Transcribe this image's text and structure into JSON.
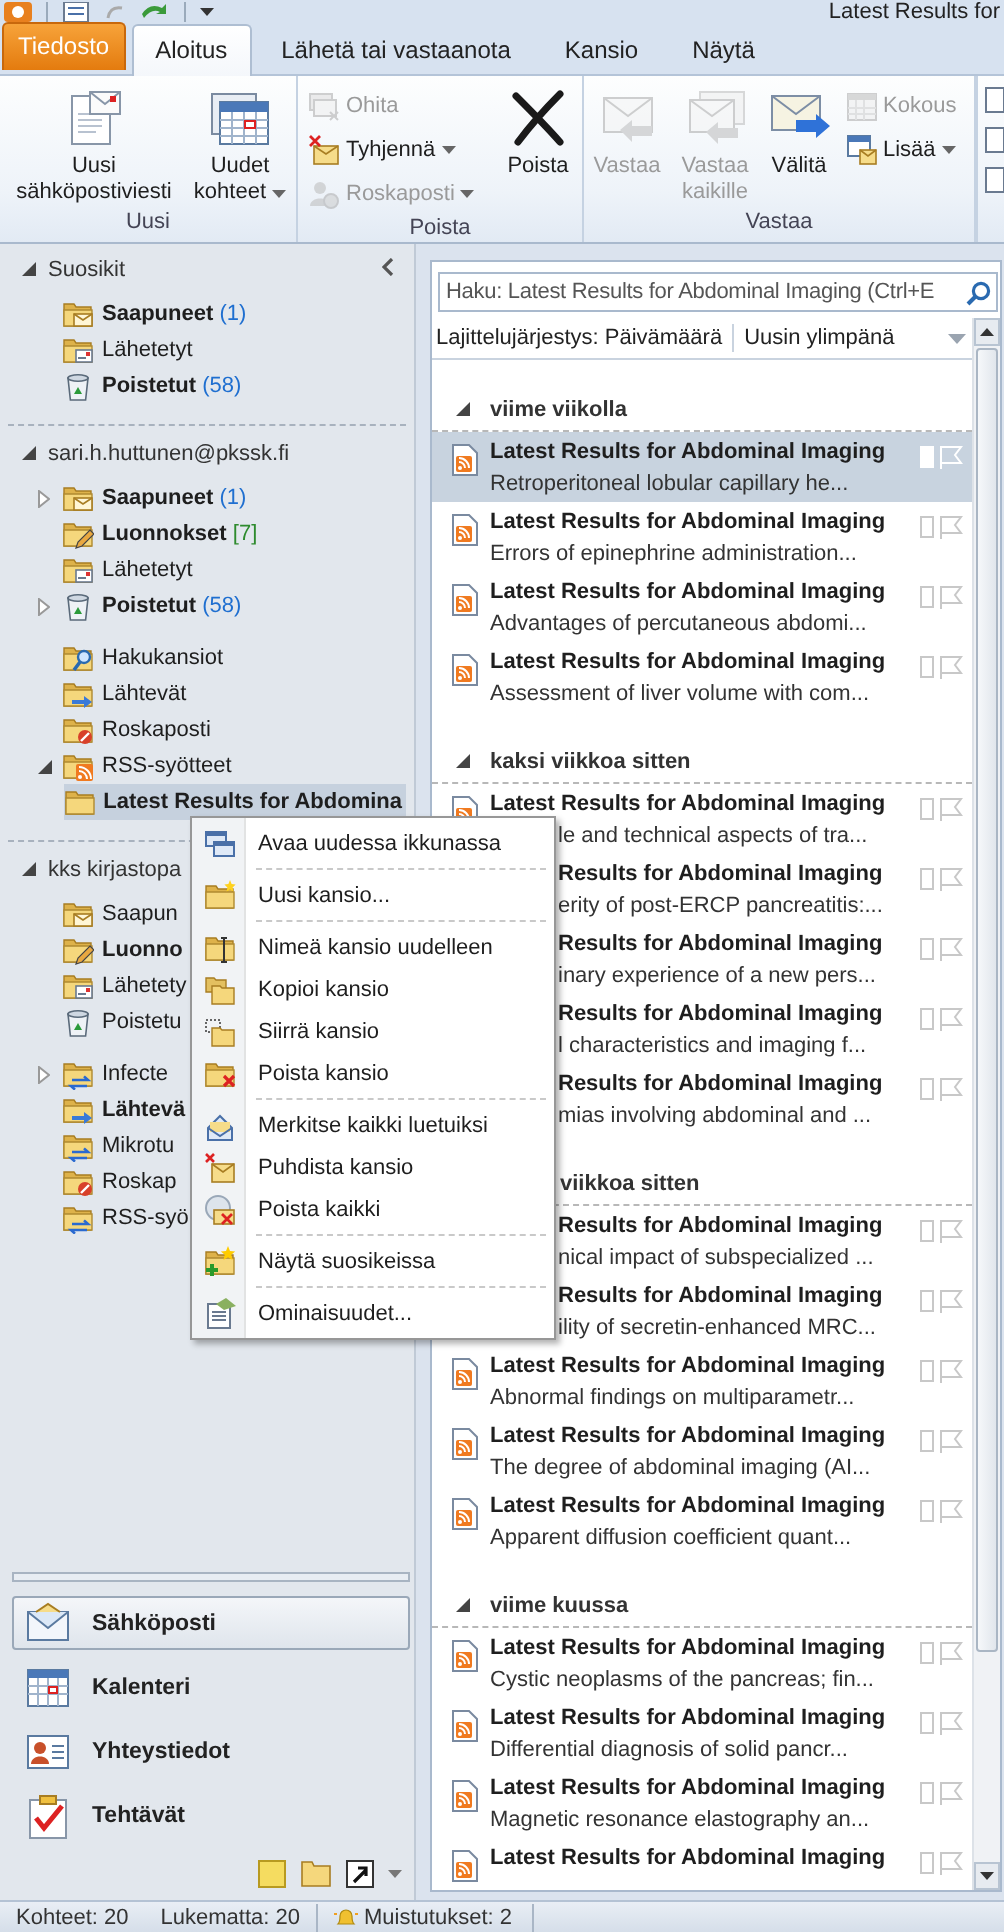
{
  "window": {
    "title": "Latest Results for"
  },
  "tabs": [
    {
      "label": "Tiedosto",
      "kind": "file",
      "selected": false
    },
    {
      "label": "Aloitus",
      "kind": "tab",
      "selected": true
    },
    {
      "label": "Lähetä tai vastaanota",
      "kind": "tab",
      "selected": false
    },
    {
      "label": "Kansio",
      "kind": "tab",
      "selected": false
    },
    {
      "label": "Näytä",
      "kind": "tab",
      "selected": false
    }
  ],
  "ribbon_groups": [
    {
      "label": "Uusi",
      "items": [
        {
          "kind": "new-mail",
          "label": "Uusi sähköpostiviesti",
          "disabled": false,
          "dropdown": false
        },
        {
          "kind": "new-items",
          "label": "Uudet kohteet",
          "disabled": false,
          "dropdown": true
        }
      ]
    },
    {
      "label": "Poista",
      "items": [
        {
          "kind": "stack",
          "buttons": [
            {
              "label": "Ohita",
              "kind": "ignore",
              "disabled": true,
              "dropdown": false
            },
            {
              "label": "Tyhjennä",
              "kind": "clean-up",
              "disabled": false,
              "dropdown": true
            },
            {
              "label": "Roskaposti",
              "kind": "junk",
              "disabled": true,
              "dropdown": true
            }
          ]
        },
        {
          "kind": "delete",
          "label": "Poista",
          "disabled": false,
          "dropdown": false
        }
      ]
    },
    {
      "label": "Vastaa",
      "items": [
        {
          "kind": "reply",
          "label": "Vastaa",
          "disabled": true,
          "dropdown": false
        },
        {
          "kind": "reply-all",
          "label": "Vastaa kaikille",
          "disabled": true,
          "dropdown": false
        },
        {
          "kind": "forward",
          "label": "Välitä",
          "disabled": false,
          "dropdown": false
        },
        {
          "kind": "stack",
          "buttons": [
            {
              "label": "Kokous",
              "kind": "meeting",
              "disabled": true,
              "dropdown": false
            },
            {
              "label": "Lisää",
              "kind": "more",
              "disabled": false,
              "dropdown": true
            }
          ]
        }
      ]
    }
  ],
  "folders": {
    "sections": [
      {
        "header": "Suosikit",
        "expanded": true,
        "groups": [
          [
            {
              "name": "Saapuneet",
              "count": "(1)",
              "bold": true,
              "kind": "inbox",
              "selected": false
            },
            {
              "name": "Lähetetyt",
              "bold": false,
              "kind": "sent",
              "selected": false
            },
            {
              "name": "Poistetut",
              "count": "(58)",
              "bold": true,
              "kind": "deleted",
              "selected": false
            }
          ]
        ]
      },
      {
        "header": "sari.h.huttunen@pkssk.fi",
        "expanded": true,
        "groups": [
          [
            {
              "name": "Saapuneet",
              "count": "(1)",
              "bold": true,
              "kind": "inbox",
              "expanded": false,
              "selected": false
            },
            {
              "name": "Luonnokset",
              "count": "[7]",
              "bold": true,
              "kind": "drafts",
              "selected": false
            },
            {
              "name": "Lähetetyt",
              "bold": false,
              "kind": "sent",
              "selected": false
            },
            {
              "name": "Poistetut",
              "count": "(58)",
              "bold": true,
              "kind": "deleted",
              "expanded": false,
              "selected": false
            }
          ],
          [
            {
              "name": "Hakukansiot",
              "bold": false,
              "kind": "search",
              "selected": false
            },
            {
              "name": "Lähtevät",
              "bold": false,
              "kind": "outbox",
              "selected": false
            },
            {
              "name": "Roskaposti",
              "bold": false,
              "kind": "junk",
              "selected": false
            },
            {
              "name": "RSS-syötteet",
              "bold": false,
              "kind": "rss",
              "expanded": true,
              "selected": false,
              "children": [
                {
                  "name": "Latest Results for Abdomina",
                  "bold": true,
                  "kind": "folder",
                  "selected": true
                }
              ]
            }
          ]
        ]
      },
      {
        "header": "kks kirjastopa",
        "expanded": true,
        "groups": [
          [
            {
              "name": "Saapun",
              "bold": false,
              "kind": "inbox",
              "selected": false
            },
            {
              "name": "Luonno",
              "bold": true,
              "kind": "drafts",
              "selected": false
            },
            {
              "name": "Lähetety",
              "bold": false,
              "kind": "sent",
              "selected": false
            },
            {
              "name": "Poistetu",
              "bold": false,
              "kind": "deleted",
              "selected": false
            }
          ],
          [
            {
              "name": "Infecte",
              "bold": false,
              "kind": "sync",
              "expanded": false,
              "selected": false
            },
            {
              "name": "Lähtevä",
              "bold": true,
              "kind": "outbox",
              "selected": false
            },
            {
              "name": "Mikrotu",
              "bold": false,
              "kind": "sync",
              "selected": false
            },
            {
              "name": "Roskap",
              "bold": false,
              "kind": "junk",
              "selected": false
            },
            {
              "name": "RSS-syö",
              "bold": false,
              "kind": "sync",
              "selected": false
            }
          ]
        ]
      }
    ]
  },
  "nav": [
    {
      "label": "Sähköposti",
      "kind": "mail",
      "selected": true
    },
    {
      "label": "Kalenteri",
      "kind": "calendar",
      "selected": false
    },
    {
      "label": "Yhteystiedot",
      "kind": "contacts",
      "selected": false
    },
    {
      "label": "Tehtävät",
      "kind": "tasks",
      "selected": false
    }
  ],
  "search": {
    "placeholder": "Haku: Latest Results for Abdominal Imaging (Ctrl+E"
  },
  "sort": {
    "field": "Lajittelujärjestys: Päivämäärä",
    "order": "Uusin ylimpänä"
  },
  "message_groups": [
    {
      "header": "viime viikolla",
      "covered": false,
      "expanded": true,
      "rows": [
        {
          "title": "Latest Results for Abdominal Imaging",
          "preview": "Retroperitoneal lobular capillary he...",
          "selected": true,
          "covered": false
        },
        {
          "title": "Latest Results for Abdominal Imaging",
          "preview": "Errors of epinephrine administration...",
          "selected": false,
          "covered": false
        },
        {
          "title": "Latest Results for Abdominal Imaging",
          "preview": "Advantages of percutaneous abdomi...",
          "selected": false,
          "covered": false
        },
        {
          "title": "Latest Results for Abdominal Imaging",
          "preview": "Assessment of liver volume with com...",
          "selected": false,
          "covered": false
        }
      ]
    },
    {
      "header": "kaksi viikkoa sitten",
      "covered": false,
      "expanded": true,
      "rows": [
        {
          "title": "Latest Results for Abdominal Imaging",
          "preview": "le and technical aspects of tra...",
          "selected": false,
          "covered": false,
          "preview_covered": true
        },
        {
          "title": "Results for Abdominal Imaging",
          "preview": "erity of post-ERCP pancreatitis:...",
          "selected": false,
          "covered": true
        },
        {
          "title": "Results for Abdominal Imaging",
          "preview": "inary experience of a new pers...",
          "selected": false,
          "covered": true
        },
        {
          "title": "Results for Abdominal Imaging",
          "preview": "l characteristics and imaging f...",
          "selected": false,
          "covered": true
        },
        {
          "title": "Results for Abdominal Imaging",
          "preview": "mias involving abdominal and ...",
          "selected": false,
          "covered": true
        }
      ]
    },
    {
      "header": "viikkoa sitten",
      "covered": true,
      "rows": [
        {
          "title": "Results for Abdominal Imaging",
          "preview": "nical impact of subspecialized ...",
          "selected": false,
          "covered": true
        },
        {
          "title": "Results for Abdominal Imaging",
          "preview": "ility of secretin-enhanced MRC...",
          "selected": false,
          "covered": true
        },
        {
          "title": "Latest Results for Abdominal Imaging",
          "preview": "Abnormal findings on multiparametr...",
          "selected": false,
          "covered": false
        },
        {
          "title": "Latest Results for Abdominal Imaging",
          "preview": "The degree of abdominal imaging (AI...",
          "selected": false,
          "covered": false
        },
        {
          "title": "Latest Results for Abdominal Imaging",
          "preview": "Apparent diffusion coefficient quant...",
          "selected": false,
          "covered": false
        }
      ]
    },
    {
      "header": "viime kuussa",
      "covered": false,
      "expanded": true,
      "rows": [
        {
          "title": "Latest Results for Abdominal Imaging",
          "preview": "Cystic neoplasms of the pancreas; fin...",
          "selected": false,
          "covered": false
        },
        {
          "title": "Latest Results for Abdominal Imaging",
          "preview": "Differential diagnosis of solid pancr...",
          "selected": false,
          "covered": false
        },
        {
          "title": "Latest Results for Abdominal Imaging",
          "preview": "Magnetic resonance elastography an...",
          "selected": false,
          "covered": false
        },
        {
          "title": "Latest Results for Abdominal Imaging",
          "selected": false,
          "covered": false
        }
      ]
    }
  ],
  "context_menu": {
    "groups": [
      [
        {
          "label": "Avaa uudessa ikkunassa",
          "kind": "new-window"
        }
      ],
      [
        {
          "label": "Uusi kansio...",
          "kind": "new-folder"
        }
      ],
      [
        {
          "label": "Nimeä kansio uudelleen",
          "kind": "rename-folder"
        },
        {
          "label": "Kopioi kansio",
          "kind": "copy-folder"
        },
        {
          "label": "Siirrä kansio",
          "kind": "move-folder"
        },
        {
          "label": "Poista kansio",
          "kind": "delete-folder"
        }
      ],
      [
        {
          "label": "Merkitse kaikki luetuiksi",
          "kind": "mark-read"
        },
        {
          "label": "Puhdista kansio",
          "kind": "clean-folder"
        },
        {
          "label": "Poista kaikki",
          "kind": "delete-all"
        }
      ],
      [
        {
          "label": "Näytä suosikeissa",
          "kind": "favorite"
        }
      ],
      [
        {
          "label": "Ominaisuudet...",
          "kind": "properties"
        }
      ]
    ]
  },
  "status_bar": {
    "items": "Kohteet: 20",
    "unread": "Lukematta: 20",
    "reminders": "Muistutukset: 2"
  }
}
